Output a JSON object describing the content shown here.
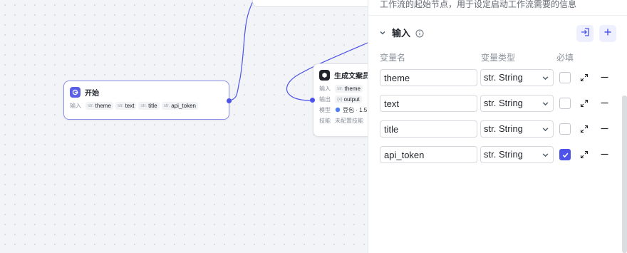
{
  "panel": {
    "description": "工作流的起始节点，用于设定启动工作流需要的信息",
    "section_title": "输入",
    "columns": {
      "name": "变量名",
      "type": "变量类型",
      "required": "必填"
    },
    "variables": [
      {
        "name": "theme",
        "type": "str. String",
        "required": false
      },
      {
        "name": "text",
        "type": "str. String",
        "required": false
      },
      {
        "name": "title",
        "type": "str. String",
        "required": false
      },
      {
        "name": "api_token",
        "type": "str. String",
        "required": true
      }
    ]
  },
  "start_node": {
    "title": "开始",
    "input_label": "输入",
    "inputs": [
      {
        "type": "str.",
        "name": "theme"
      },
      {
        "type": "str.",
        "name": "text"
      },
      {
        "type": "str.",
        "name": "title"
      },
      {
        "type": "str.",
        "name": "api_token"
      }
    ]
  },
  "llm_node": {
    "title": "生成文案员",
    "input_label": "输入",
    "input_type": "str.",
    "input_name": "theme",
    "output_label": "输出",
    "output_type": "{x}",
    "output_name": "output",
    "model_label": "模型",
    "model_value": "豆包 · 1.5",
    "skill_label": "技能",
    "skill_value": "未配置技能"
  },
  "colors": {
    "accent": "#4d53e8",
    "node_border_selected": "#8c8fe8",
    "canvas_bg": "#f3f4f7"
  },
  "icons": {
    "start": "start-node-icon",
    "llm": "llm-node-icon",
    "collapse": "chevron-down-icon",
    "info": "info-icon",
    "import": "import-icon",
    "add": "plus-icon",
    "expand": "expand-icon",
    "remove": "minus-icon"
  }
}
